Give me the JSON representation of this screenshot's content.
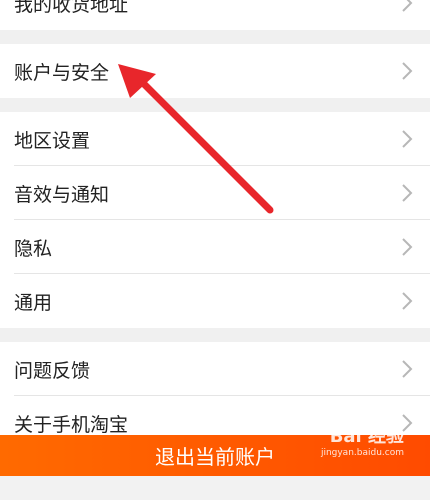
{
  "groups": [
    {
      "items": [
        {
          "label": "我的收货地址"
        }
      ]
    },
    {
      "items": [
        {
          "label": "账户与安全"
        }
      ]
    },
    {
      "items": [
        {
          "label": "地区设置"
        },
        {
          "label": "音效与通知"
        },
        {
          "label": "隐私"
        },
        {
          "label": "通用"
        }
      ]
    },
    {
      "items": [
        {
          "label": "问题反馈"
        },
        {
          "label": "关于手机淘宝"
        }
      ]
    }
  ],
  "logout_label": "退出当前账户",
  "watermark": {
    "brand": "Bai 经验",
    "site": "jingyan.baidu.com"
  },
  "colors": {
    "accent": "#ff5a00",
    "arrow": "#e8262b"
  }
}
